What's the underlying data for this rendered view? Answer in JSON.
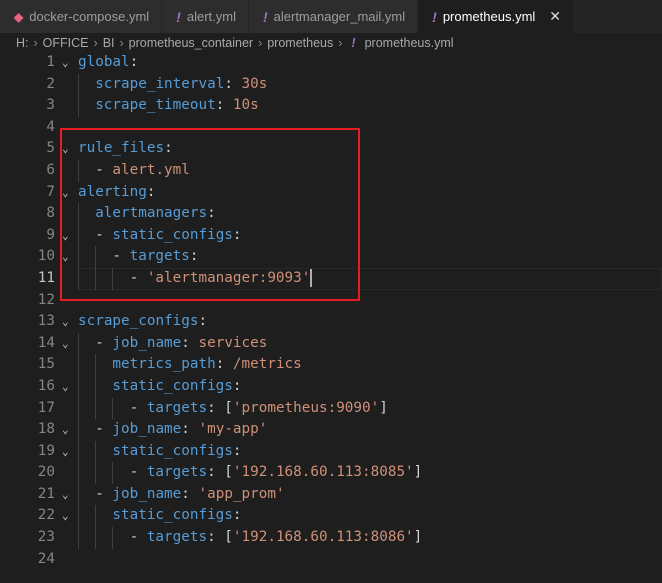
{
  "tabs": [
    {
      "label": "docker-compose.yml",
      "icon": "docker-icon",
      "active": false
    },
    {
      "label": "alert.yml",
      "icon": "yaml-icon",
      "active": false
    },
    {
      "label": "alertmanager_mail.yml",
      "icon": "yaml-icon",
      "active": false
    },
    {
      "label": "prometheus.yml",
      "icon": "yaml-icon",
      "active": true
    }
  ],
  "close_glyph": "✕",
  "breadcrumb": [
    "H:",
    "OFFICE",
    "BI",
    "prometheus_container",
    "prometheus",
    "prometheus.yml"
  ],
  "breadcrumb_sep": "›",
  "yaml_glyph": "!",
  "docker_glyph": "◆",
  "current_line": 11,
  "lines": [
    {
      "n": "1",
      "fold": true,
      "indent": 0,
      "tokens": [
        [
          "k",
          "global"
        ],
        [
          "p",
          ":"
        ]
      ]
    },
    {
      "n": "2",
      "indent": 1,
      "tokens": [
        [
          "k",
          "scrape_interval"
        ],
        [
          "p",
          ": "
        ],
        [
          "v",
          "30s"
        ]
      ]
    },
    {
      "n": "3",
      "indent": 1,
      "tokens": [
        [
          "k",
          "scrape_timeout"
        ],
        [
          "p",
          ": "
        ],
        [
          "v",
          "10s"
        ]
      ]
    },
    {
      "n": "4",
      "indent": 0,
      "tokens": []
    },
    {
      "n": "5",
      "fold": true,
      "indent": 0,
      "tokens": [
        [
          "k",
          "rule_files"
        ],
        [
          "p",
          ":"
        ]
      ]
    },
    {
      "n": "6",
      "indent": 1,
      "tokens": [
        [
          "p",
          "- "
        ],
        [
          "v",
          "alert.yml"
        ]
      ]
    },
    {
      "n": "7",
      "fold": true,
      "indent": 0,
      "tokens": [
        [
          "k",
          "alerting"
        ],
        [
          "p",
          ":"
        ]
      ]
    },
    {
      "n": "8",
      "indent": 1,
      "tokens": [
        [
          "k",
          "alertmanagers"
        ],
        [
          "p",
          ":"
        ]
      ]
    },
    {
      "n": "9",
      "fold": true,
      "indent": 1,
      "tokens": [
        [
          "p",
          "- "
        ],
        [
          "k",
          "static_configs"
        ],
        [
          "p",
          ":"
        ]
      ]
    },
    {
      "n": "10",
      "fold": true,
      "indent": 2,
      "tokens": [
        [
          "p",
          "- "
        ],
        [
          "k",
          "targets"
        ],
        [
          "p",
          ":"
        ]
      ]
    },
    {
      "n": "11",
      "indent": 3,
      "tokens": [
        [
          "p",
          "- "
        ],
        [
          "v",
          "'alertmanager:9093'"
        ]
      ]
    },
    {
      "n": "12",
      "indent": 0,
      "tokens": []
    },
    {
      "n": "13",
      "fold": true,
      "indent": 0,
      "tokens": [
        [
          "k",
          "scrape_configs"
        ],
        [
          "p",
          ":"
        ]
      ]
    },
    {
      "n": "14",
      "fold": true,
      "indent": 1,
      "tokens": [
        [
          "p",
          "- "
        ],
        [
          "k",
          "job_name"
        ],
        [
          "p",
          ": "
        ],
        [
          "v",
          "services"
        ]
      ]
    },
    {
      "n": "15",
      "indent": 2,
      "tokens": [
        [
          "k",
          "metrics_path"
        ],
        [
          "p",
          ": "
        ],
        [
          "v",
          "/metrics"
        ]
      ]
    },
    {
      "n": "16",
      "fold": true,
      "indent": 2,
      "tokens": [
        [
          "k",
          "static_configs"
        ],
        [
          "p",
          ":"
        ]
      ]
    },
    {
      "n": "17",
      "indent": 3,
      "tokens": [
        [
          "p",
          "- "
        ],
        [
          "k",
          "targets"
        ],
        [
          "p",
          ": ["
        ],
        [
          "v",
          "'prometheus:9090'"
        ],
        [
          "p",
          "]"
        ]
      ]
    },
    {
      "n": "18",
      "fold": true,
      "indent": 1,
      "tokens": [
        [
          "p",
          "- "
        ],
        [
          "k",
          "job_name"
        ],
        [
          "p",
          ": "
        ],
        [
          "v",
          "'my-app'"
        ]
      ]
    },
    {
      "n": "19",
      "fold": true,
      "indent": 2,
      "tokens": [
        [
          "k",
          "static_configs"
        ],
        [
          "p",
          ":"
        ]
      ]
    },
    {
      "n": "20",
      "indent": 3,
      "tokens": [
        [
          "p",
          "- "
        ],
        [
          "k",
          "targets"
        ],
        [
          "p",
          ": ["
        ],
        [
          "v",
          "'192.168.60.113:8085'"
        ],
        [
          "p",
          "]"
        ]
      ]
    },
    {
      "n": "21",
      "fold": true,
      "indent": 1,
      "tokens": [
        [
          "p",
          "- "
        ],
        [
          "k",
          "job_name"
        ],
        [
          "p",
          ": "
        ],
        [
          "v",
          "'app_prom'"
        ]
      ]
    },
    {
      "n": "22",
      "fold": true,
      "indent": 2,
      "tokens": [
        [
          "k",
          "static_configs"
        ],
        [
          "p",
          ":"
        ]
      ]
    },
    {
      "n": "23",
      "indent": 3,
      "tokens": [
        [
          "p",
          "- "
        ],
        [
          "k",
          "targets"
        ],
        [
          "p",
          ": ["
        ],
        [
          "v",
          "'192.168.60.113:8086'"
        ],
        [
          "p",
          "]"
        ]
      ]
    },
    {
      "n": "24",
      "indent": 0,
      "tokens": []
    }
  ]
}
